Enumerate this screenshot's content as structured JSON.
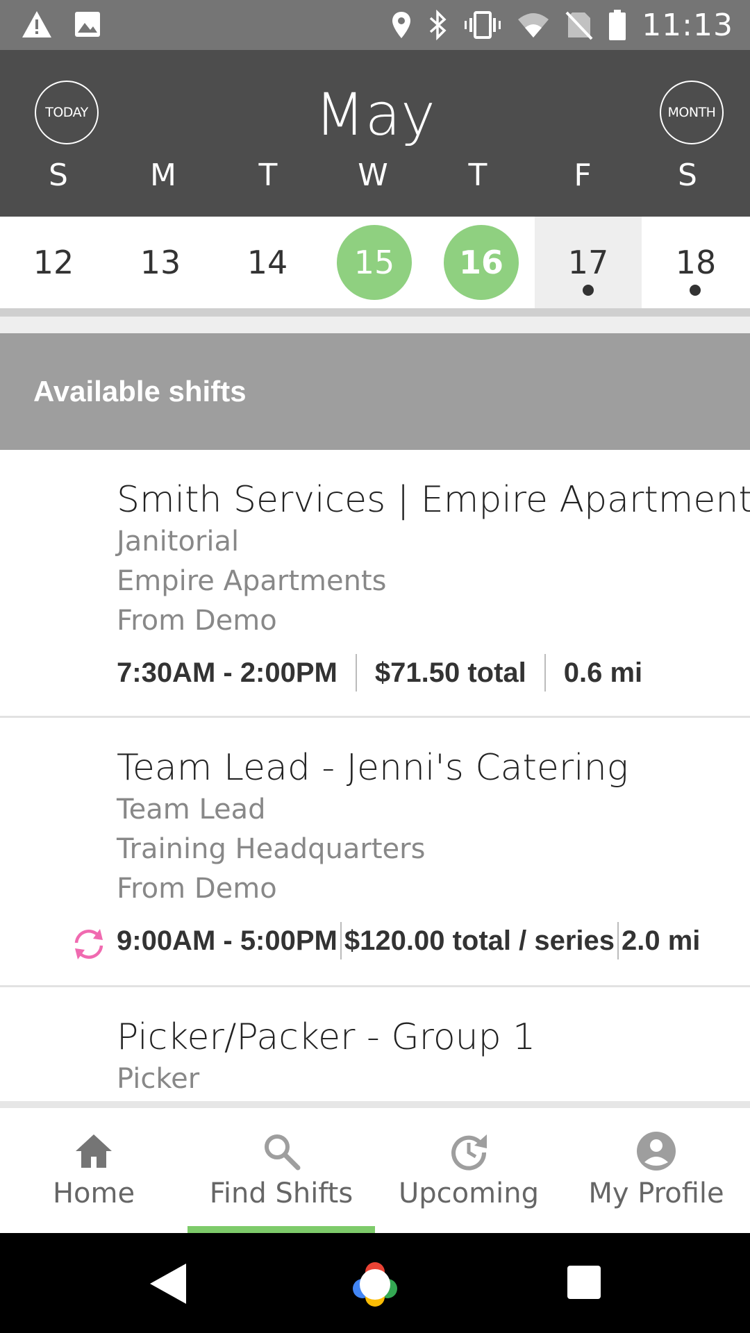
{
  "status_bar": {
    "time": "11:13",
    "icons": [
      "warning-icon",
      "image-icon",
      "location-icon",
      "bluetooth-icon",
      "vibrate-icon",
      "wifi-icon",
      "no-sim-icon",
      "battery-icon"
    ]
  },
  "calendar": {
    "today_label": "TODAY",
    "month_button_label": "MONTH",
    "month": "May",
    "weekdays": [
      "S",
      "M",
      "T",
      "W",
      "T",
      "F",
      "S"
    ],
    "days": [
      {
        "num": "12",
        "state": "normal",
        "has_event": false
      },
      {
        "num": "13",
        "state": "normal",
        "has_event": false
      },
      {
        "num": "14",
        "state": "normal",
        "has_event": false
      },
      {
        "num": "15",
        "state": "green",
        "has_event": false
      },
      {
        "num": "16",
        "state": "green-bold",
        "has_event": false
      },
      {
        "num": "17",
        "state": "selected",
        "has_event": true
      },
      {
        "num": "18",
        "state": "normal",
        "has_event": true
      }
    ],
    "accent_color": "#8fd080"
  },
  "section": {
    "title": "Available shifts"
  },
  "shifts": [
    {
      "title": "Smith Services | Empire Apartments",
      "role": "Janitorial",
      "location": "Empire Apartments",
      "source": "From Demo",
      "time": "7:30AM - 2:00PM",
      "pay": "$71.50 total",
      "distance": "0.6 mi",
      "recurring": false
    },
    {
      "title": "Team Lead - Jenni's Catering",
      "role": "Team Lead",
      "location": "Training Headquarters",
      "source": "From Demo",
      "time": "9:00AM - 5:00PM",
      "pay": "$120.00 total / series",
      "distance": "2.0 mi",
      "recurring": true
    },
    {
      "title": "Picker/Packer - Group 1",
      "role": "Picker"
    }
  ],
  "bottom_nav": {
    "items": [
      {
        "label": "Home",
        "icon": "home-icon"
      },
      {
        "label": "Find Shifts",
        "icon": "search-icon",
        "active": true
      },
      {
        "label": "Upcoming",
        "icon": "history-icon"
      },
      {
        "label": "My Profile",
        "icon": "account-icon"
      }
    ],
    "active_color": "#7ecb6a"
  },
  "system_nav": {
    "icons": [
      "back-icon",
      "home-circle-icon",
      "recents-icon"
    ]
  }
}
